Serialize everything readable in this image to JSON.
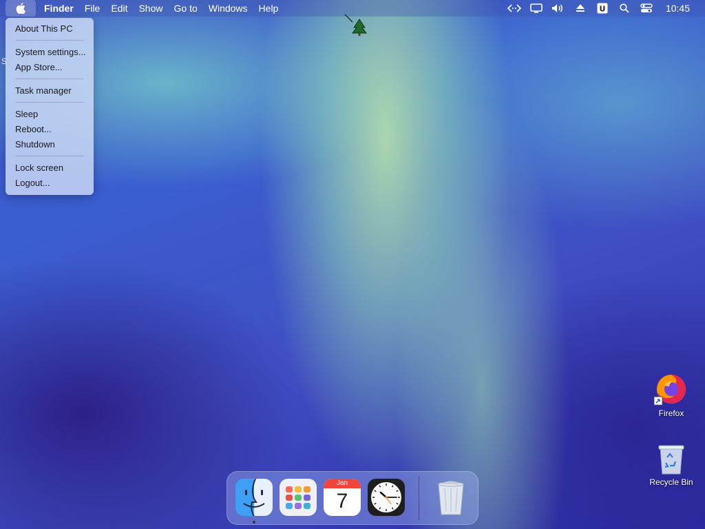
{
  "menubar": {
    "apple_icon": "apple-icon",
    "items": [
      {
        "label": "Finder",
        "bold": true
      },
      {
        "label": "File"
      },
      {
        "label": "Edit"
      },
      {
        "label": "Show"
      },
      {
        "label": "Go to"
      },
      {
        "label": "Windows"
      },
      {
        "label": "Help"
      }
    ],
    "status_icons": [
      "code-icon",
      "display-icon",
      "volume-icon",
      "eject-icon",
      "user-u-icon",
      "search-icon",
      "control-center-icon"
    ],
    "clock": "10:45"
  },
  "apple_menu": {
    "items": [
      {
        "label": "About This PC"
      },
      {
        "separator": true
      },
      {
        "label": "System settings..."
      },
      {
        "label": "App Store..."
      },
      {
        "separator": true
      },
      {
        "label": "Task manager"
      },
      {
        "separator": true
      },
      {
        "label": "Sleep"
      },
      {
        "label": "Reboot..."
      },
      {
        "label": "Shutdown"
      },
      {
        "separator": true
      },
      {
        "label": "Lock screen"
      },
      {
        "label": "Logout..."
      }
    ]
  },
  "desktop": {
    "stray_text": "S",
    "icons": [
      {
        "label": "Firefox",
        "icon": "firefox-icon"
      },
      {
        "label": "Recycle Bin",
        "icon": "recycle-bin-icon"
      }
    ]
  },
  "dock": {
    "apps": [
      {
        "name": "Finder",
        "icon": "finder-icon",
        "running": true
      },
      {
        "name": "Launchpad",
        "icon": "launchpad-icon",
        "running": false
      },
      {
        "name": "Calendar",
        "icon": "calendar-icon",
        "month": "Jan",
        "day": "7",
        "running": false
      },
      {
        "name": "Clock",
        "icon": "clock-icon",
        "running": false
      },
      {
        "name": "Trash",
        "icon": "trash-icon",
        "running": false
      }
    ]
  },
  "colors": {
    "wallpaper_base": "#3e54c8",
    "aurora_green": "#bfe9aa",
    "calendar_red": "#f0453a"
  }
}
